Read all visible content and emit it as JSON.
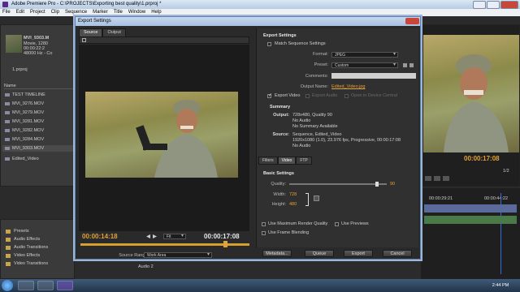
{
  "window": {
    "title": "Adobe Premiere Pro - C:\\PROJECTS\\Exporting best quality\\1.prproj *"
  },
  "menu": [
    "File",
    "Edit",
    "Project",
    "Clip",
    "Sequence",
    "Marker",
    "Title",
    "Window",
    "Help"
  ],
  "project_panel": {
    "clip_name": "MVI_9303.M",
    "clip_info": [
      "Movie, 1280",
      "00:00:22:2",
      "48000 Hz - Co"
    ],
    "project_file": "1.prproj",
    "name_header": "Name",
    "items": [
      "TEST TIMELINE",
      "MVI_9276.MOV",
      "MVI_9279.MOV",
      "MVI_9281.MOV",
      "MVI_9282.MOV",
      "MVI_9284.MOV",
      "MVI_9303.MOV",
      "Edited_Video"
    ],
    "selected_index": 6
  },
  "effects_panel": {
    "folders": [
      "Presets",
      "Audio Effects",
      "Audio Transitions",
      "Video Effects",
      "Video Transitions"
    ]
  },
  "dialog": {
    "title": "Export Settings",
    "tabs": [
      "Source",
      "Output"
    ],
    "active_tab": "Source",
    "current_time": "00:00:14:18",
    "duration": "00:00:17:08",
    "fit": "Fit",
    "source_range_label": "Source Range:",
    "source_range_value": "Work Area",
    "export_settings": {
      "header": "Export Settings",
      "match_sequence": "Match Sequence Settings",
      "format_label": "Format:",
      "format_value": "JPEG",
      "preset_label": "Preset:",
      "preset_value": "Custom",
      "comments_label": "Comments:",
      "output_name_label": "Output Name:",
      "output_name_value": "Edited_Video.jpg",
      "export_video": "Export Video",
      "export_audio": "Export Audio",
      "open_device_central": "Open in Device Central"
    },
    "summary": {
      "header": "Summary",
      "output_label": "Output:",
      "output_lines": [
        "728x480, Quality 90",
        "No Audio",
        "No Summary Available"
      ],
      "source_label": "Source:",
      "source_lines": [
        "Sequence, Edited_Video",
        "1920x1080 (1.0), 23.976 fps, Progressive, 00:00:17:08",
        "No Audio"
      ]
    },
    "sub_tabs": [
      "Filters",
      "Video",
      "FTP"
    ],
    "active_sub_tab": "Video",
    "basic_settings": {
      "header": "Basic Settings",
      "quality_label": "Quality:",
      "quality_value": "90",
      "width_label": "Width:",
      "width_value": "728",
      "height_label": "Height:",
      "height_value": "480"
    },
    "options": {
      "max_render": "Use Maximum Render Quality",
      "use_previews": "Use Previews",
      "frame_blending": "Use Frame Blending"
    },
    "buttons": {
      "metadata": "Metadata...",
      "queue": "Queue",
      "export": "Export",
      "cancel": "Cancel"
    }
  },
  "program_monitor": {
    "timecode": "00:00:17:08",
    "zoom": "1/2",
    "timeline_time": "00:00:29:21",
    "timeline_time2": "00:00:44:22"
  },
  "timeline": {
    "track_label": "Audio 2"
  },
  "taskbar": {
    "time": "2:44 PM"
  },
  "colors": {
    "accent_timecode": "#e0a23a",
    "playhead": "#3a6ad8"
  }
}
